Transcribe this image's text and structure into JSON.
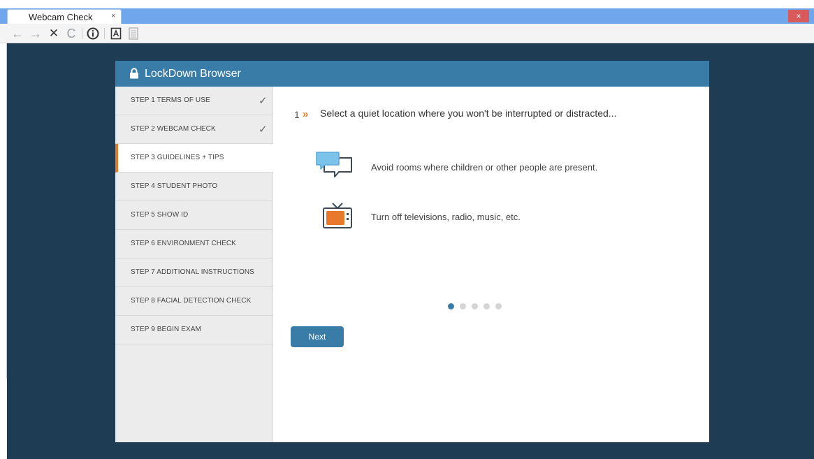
{
  "browser": {
    "tab_title": "Webcam Check",
    "tab_close": "×",
    "window_close": "×",
    "toolbar": {
      "back": "←",
      "forward": "→",
      "stop": "✕",
      "reload": "C",
      "info": "i"
    }
  },
  "app": {
    "title": "LockDown Browser",
    "accent": "#e8792c",
    "header_color": "#3a7ca8"
  },
  "steps": [
    {
      "label": "STEP 1 TERMS OF USE",
      "check": "✓"
    },
    {
      "label": "STEP 2 WEBCAM CHECK",
      "check": "✓"
    },
    {
      "label": "STEP 3 GUIDELINES + TIPS"
    },
    {
      "label": "STEP 4 STUDENT PHOTO"
    },
    {
      "label": "STEP 5 SHOW ID"
    },
    {
      "label": "STEP 6 ENVIRONMENT CHECK"
    },
    {
      "label": "STEP 7 ADDITIONAL INSTRUCTIONS"
    },
    {
      "label": "STEP 8 FACIAL DETECTION CHECK"
    },
    {
      "label": "STEP 9 BEGIN EXAM"
    }
  ],
  "guideline": {
    "number": "1",
    "chevron": "»",
    "headline": "Select a quiet location where you won't be interrupted or distracted...",
    "tips": [
      {
        "icon": "chat-bubbles-icon",
        "text": "Avoid rooms where children or other people are present."
      },
      {
        "icon": "television-icon",
        "text": "Turn off televisions, radio, music, etc."
      }
    ]
  },
  "pager": {
    "total": 5,
    "current": 1
  },
  "next_label": "Next"
}
